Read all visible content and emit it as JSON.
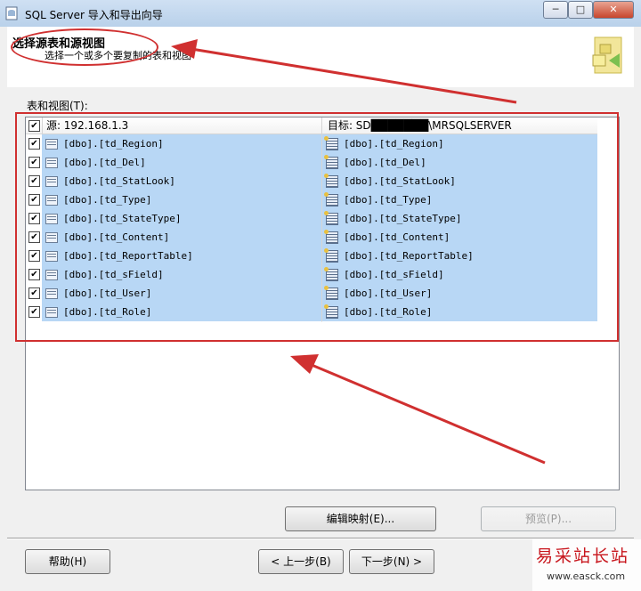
{
  "window": {
    "title": "SQL Server 导入和导出向导",
    "buttons": {
      "minimize": "─",
      "maximize": "□",
      "close": "✕"
    }
  },
  "header": {
    "title": "选择源表和源视图",
    "subtitle": "选择一个或多个要复制的表和视图"
  },
  "tables_label": "表和视图(T):",
  "grid": {
    "source_header": "源: 192.168.1.3",
    "dest_header": "目标: SD███████\\MRSQLSERVER",
    "rows": [
      {
        "source": "[dbo].[td_Region]",
        "dest": "[dbo].[td_Region]",
        "checked": true
      },
      {
        "source": "[dbo].[td_Del]",
        "dest": "[dbo].[td_Del]",
        "checked": true
      },
      {
        "source": "[dbo].[td_StatLook]",
        "dest": "[dbo].[td_StatLook]",
        "checked": true
      },
      {
        "source": "[dbo].[td_Type]",
        "dest": "[dbo].[td_Type]",
        "checked": true
      },
      {
        "source": "[dbo].[td_StateType]",
        "dest": "[dbo].[td_StateType]",
        "checked": true
      },
      {
        "source": "[dbo].[td_Content]",
        "dest": "[dbo].[td_Content]",
        "checked": true
      },
      {
        "source": "[dbo].[td_ReportTable]",
        "dest": "[dbo].[td_ReportTable]",
        "checked": true
      },
      {
        "source": "[dbo].[td_sField]",
        "dest": "[dbo].[td_sField]",
        "checked": true
      },
      {
        "source": "[dbo].[td_User]",
        "dest": "[dbo].[td_User]",
        "checked": true
      },
      {
        "source": "[dbo].[td_Role]",
        "dest": "[dbo].[td_Role]",
        "checked": true
      }
    ]
  },
  "buttons": {
    "edit_mappings": "编辑映射(E)...",
    "preview": "预览(P)...",
    "help": "帮助(H)",
    "back": "< 上一步(B)",
    "next": "下一步(N) >"
  },
  "watermark": {
    "main": "易采站长站",
    "url": "www.easck.com"
  },
  "colors": {
    "selection": "#b8d7f5",
    "annotation": "#d03030",
    "watermark": "#c8161d"
  }
}
